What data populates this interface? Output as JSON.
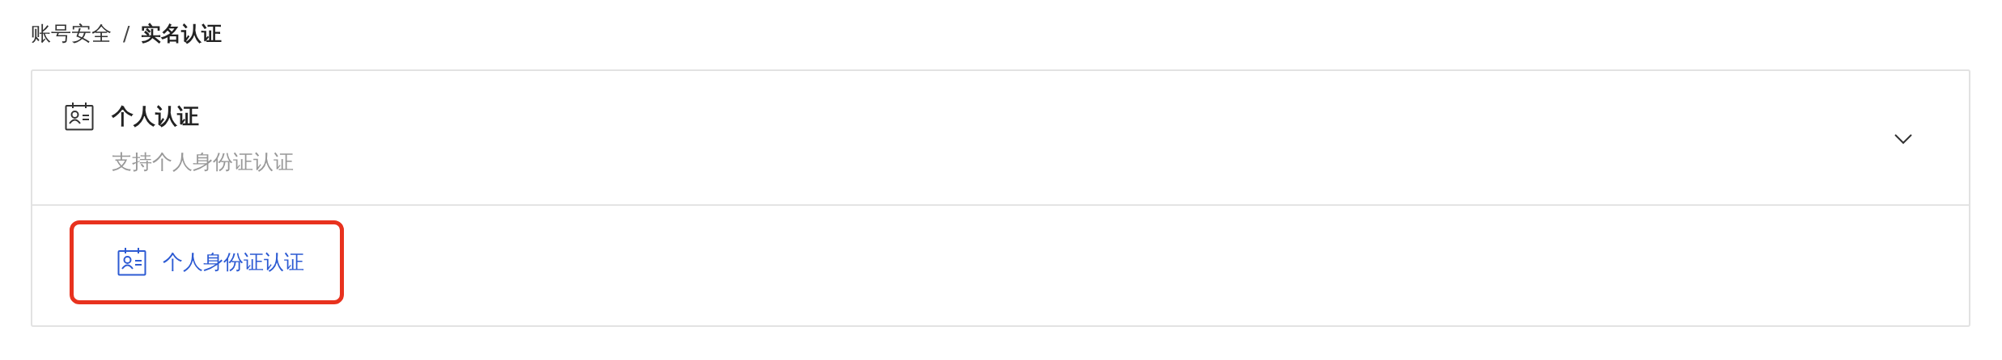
{
  "breadcrumb": [
    {
      "label": "账号安全",
      "current": false
    },
    {
      "label": "实名认证",
      "current": true
    }
  ],
  "breadcrumb_separator": "/",
  "section": {
    "title": "个人认证",
    "subtitle": "支持个人身份证认证",
    "expanded": true,
    "options": [
      {
        "label": "个人身份证认证",
        "highlighted": true
      }
    ]
  }
}
